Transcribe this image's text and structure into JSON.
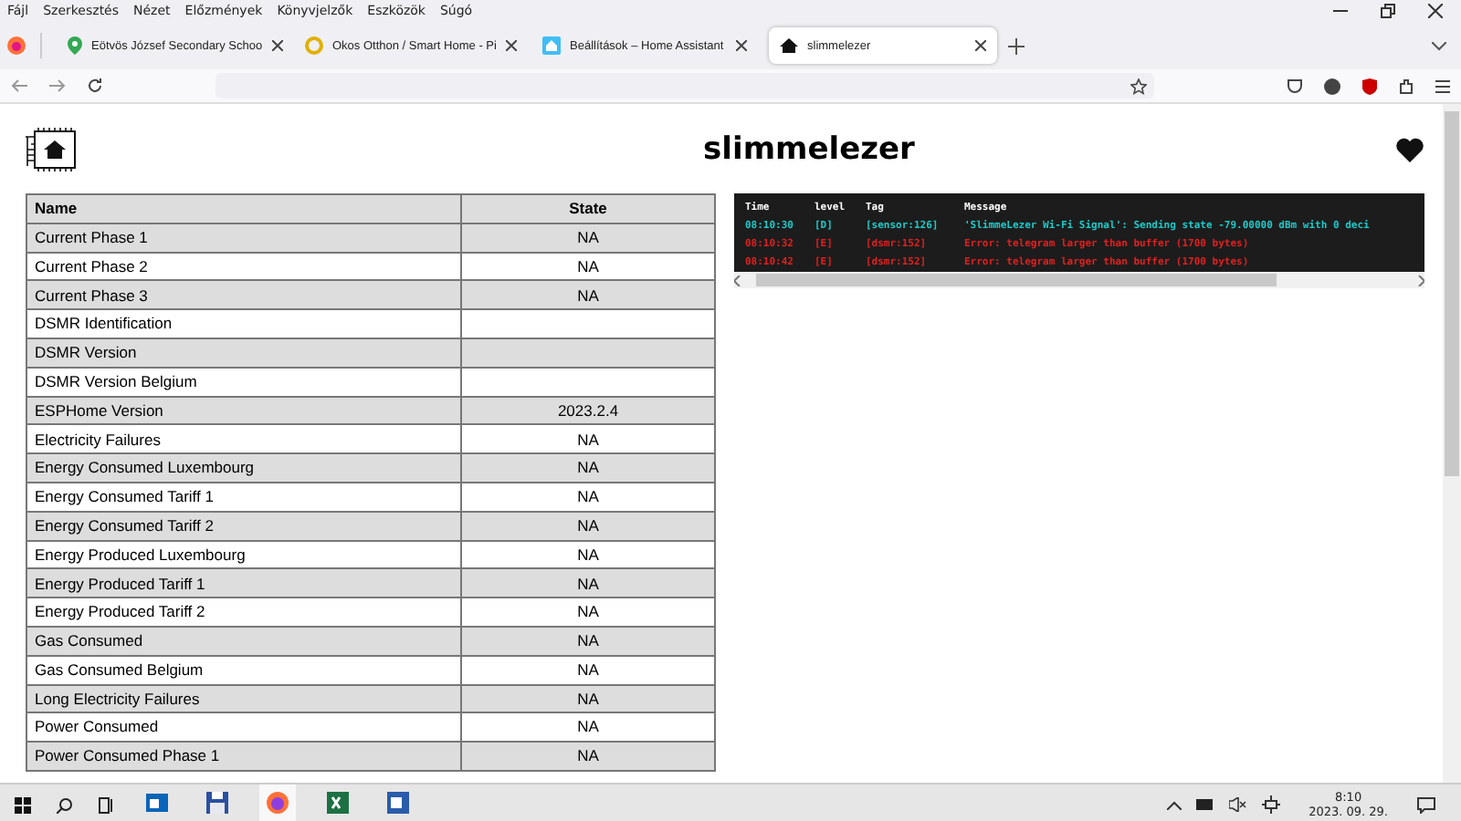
{
  "menu_bar": [
    "Fájl",
    "Szerkesztés",
    "Nézet",
    "Előzmények",
    "Könyvjelzők",
    "Eszközök",
    "Súgó"
  ],
  "tabs": [
    {
      "kind": "map",
      "label": "Eötvös József Secondary Schoo",
      "selected": false
    },
    {
      "kind": "circle",
      "label": "Okos Otthon / Smart Home - Pi",
      "selected": false
    },
    {
      "kind": "assistant",
      "label": "Beállítások – Home Assistant",
      "selected": false
    },
    {
      "kind": "house",
      "label": "slimmelezer",
      "selected": true
    }
  ],
  "page": {
    "title": "slimmelezer",
    "table": {
      "columns": [
        "Name",
        "State"
      ],
      "rows": [
        {
          "name": "Current Phase 1",
          "state": "NA"
        },
        {
          "name": "Current Phase 2",
          "state": "NA"
        },
        {
          "name": "Current Phase 3",
          "state": "NA"
        },
        {
          "name": "DSMR Identification"
        },
        {
          "name": "DSMR Version"
        },
        {
          "name": "DSMR Version Belgium"
        },
        {
          "name": "ESPHome Version",
          "state": "2023.2.4"
        },
        {
          "name": "Electricity Failures",
          "state": "NA"
        },
        {
          "name": "Energy Consumed Luxembourg",
          "state": "NA"
        },
        {
          "name": "Energy Consumed Tariff 1",
          "state": "NA"
        },
        {
          "name": "Energy Consumed Tariff 2",
          "state": "NA"
        },
        {
          "name": "Energy Produced Luxembourg",
          "state": "NA"
        },
        {
          "name": "Energy Produced Tariff 1",
          "state": "NA"
        },
        {
          "name": "Energy Produced Tariff 2",
          "state": "NA"
        },
        {
          "name": "Gas Consumed",
          "state": "NA"
        },
        {
          "name": "Gas Consumed Belgium",
          "state": "NA"
        },
        {
          "name": "Long Electricity Failures",
          "state": "NA"
        },
        {
          "name": "Power Consumed",
          "state": "NA"
        },
        {
          "name": "Power Consumed Phase 1",
          "state": "NA"
        }
      ]
    },
    "log": {
      "columns": [
        "Time",
        "level",
        "Tag",
        "Message"
      ],
      "rows": [
        {
          "kind": "debug",
          "time": "08:10:30",
          "level_tag": "[D]",
          "tag": "[sensor:126]",
          "message": "'SlimmeLezer Wi-Fi Signal': Sending state -79.00000 dBm with 0 deci"
        },
        {
          "kind": "error",
          "time": "08:10:32",
          "level_tag": "[E]",
          "tag": "[dsmr:152]",
          "message": "Error: telegram larger than buffer (1700 bytes)"
        },
        {
          "kind": "error",
          "time": "08:10:42",
          "level_tag": "[E]",
          "tag": "[dsmr:152]",
          "message": "Error: telegram larger than buffer (1700 bytes)"
        }
      ]
    }
  },
  "taskbar": {
    "apps": [
      {
        "kind": "mail",
        "selected": false
      },
      {
        "kind": "disk",
        "selected": false
      },
      {
        "kind": "browser",
        "selected": true
      },
      {
        "kind": "sheet",
        "selected": false
      },
      {
        "kind": "doc",
        "selected": false
      }
    ],
    "time": "8:10",
    "date": "2023. 09. 29."
  }
}
